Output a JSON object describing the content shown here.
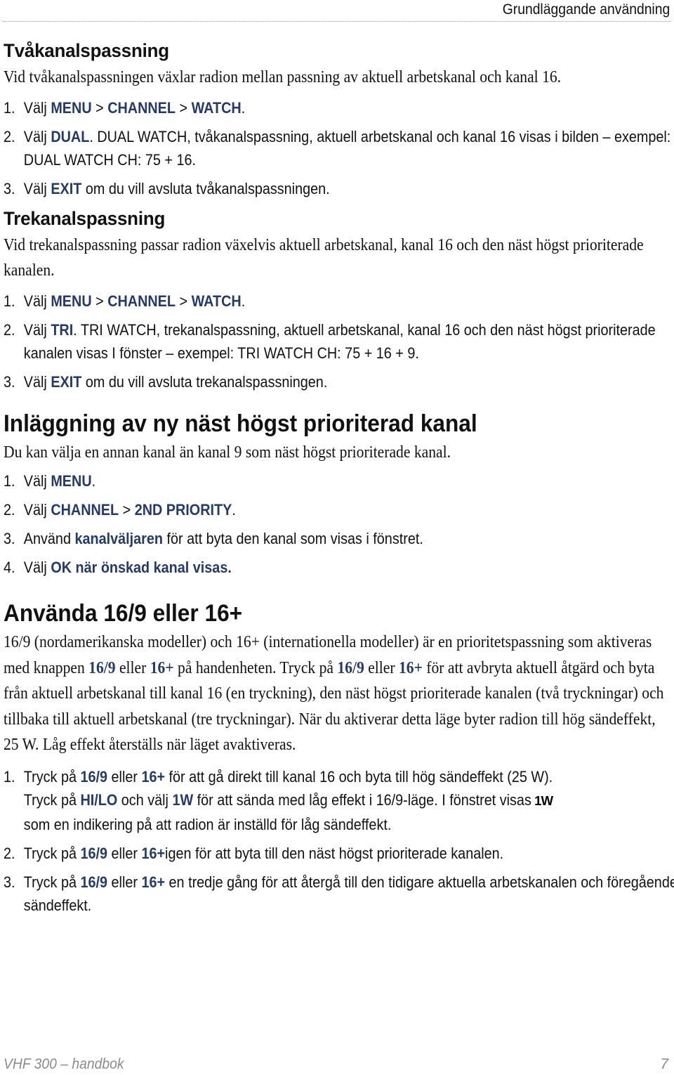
{
  "header": {
    "section_title": "Grundläggande användning"
  },
  "sections": {
    "dual": {
      "heading": "Tvåkanalspassning",
      "intro": "Vid tvåkanalspassningen växlar radion mellan passning av aktuell arbetskanal och kanal 16.",
      "steps": [
        {
          "num": "1.",
          "pre": "Välj ",
          "k1": "MENU",
          "m1": " > ",
          "k2": "CHANNEL",
          "m2": " > ",
          "k3": "WATCH",
          "post": "."
        },
        {
          "num": "2.",
          "pre": "Välj ",
          "k1": "DUAL",
          "post": ". DUAL WATCH, tvåkanalspassning, aktuell arbetskanal och kanal 16 visas i bilden – exempel: DUAL WATCH CH: 75 + 16."
        },
        {
          "num": "3.",
          "pre": "Välj ",
          "k1": "EXIT",
          "post": " om du vill avsluta tvåkanalspassningen."
        }
      ]
    },
    "tri": {
      "heading": "Trekanalspassning",
      "intro": "Vid trekanalspassning passar radion växelvis aktuell arbetskanal, kanal 16 och den näst högst prioriterade kanalen.",
      "steps": [
        {
          "num": "1.",
          "pre": "Välj ",
          "k1": "MENU",
          "m1": " > ",
          "k2": "CHANNEL",
          "m2": " > ",
          "k3": "WATCH",
          "post": "."
        },
        {
          "num": "2.",
          "pre": "Välj ",
          "k1": "TRI",
          "post": ". TRI WATCH, trekanalspassning, aktuell arbetskanal, kanal 16 och den näst högst prioriterade kanalen visas I fönster – exempel: TRI WATCH CH: 75 + 16 + 9."
        },
        {
          "num": "3.",
          "pre": "Välj ",
          "k1": "EXIT",
          "post": " om du vill avsluta trekanalspassningen."
        }
      ]
    },
    "priority": {
      "heading": "Inläggning av ny näst högst prioriterad kanal",
      "intro": "Du kan välja en annan kanal än kanal 9 som näst högst prioriterade kanal.",
      "steps": [
        {
          "num": "1.",
          "pre": "Välj ",
          "k1": "MENU",
          "post": "."
        },
        {
          "num": "2.",
          "pre": "Välj ",
          "k1": "CHANNEL",
          "m1": " > ",
          "k2": "2ND PRIORITY",
          "post": "."
        },
        {
          "num": "3.",
          "pre": "Använd ",
          "k1": "kanalväljaren",
          "post": " för att byta den kanal som visas i fönstret."
        },
        {
          "num": "4.",
          "pre": "Välj ",
          "k1": "OK när önskad kanal visas.",
          "post": ""
        }
      ]
    },
    "sixteen": {
      "heading": "Använda 16/9 eller 16+",
      "intro": {
        "p1": "16/9 (nordamerikanska modeller) och 16+ (internationella modeller) är en prioritetspassning som aktiveras med knappen ",
        "k1": "16/9",
        "p2": " eller ",
        "k2": "16+",
        "p3": " på handenheten. Tryck på ",
        "k3": "16/9",
        "p4": " eller ",
        "k4": "16+",
        "p5": " för att avbryta aktuell åtgärd och byta från aktuell arbetskanal till kanal 16 (en tryckning), den näst högst prioriterade kanalen (två tryckningar) och tillbaka till aktuell arbetskanal (tre tryckningar). När du aktiverar detta läge byter radion till hög sändeffekt,",
        "p6": "25 W. Låg effekt återställs när läget avaktiveras."
      },
      "steps": [
        {
          "num": "1.",
          "t1": "Tryck på ",
          "k1": "16/9",
          "t2": " eller ",
          "k2": "16+",
          "t3": " för att gå direkt till kanal 16 och byta till hög sändeffekt (25 W).",
          "t4": "Tryck på ",
          "k3": "HI/LO",
          "t5": " och välj ",
          "k4": "1W",
          "t6": " för att sända med låg effekt i 16/9-läge. I fönstret visas ",
          "icon_label": "1W",
          "t7": "som en indikering på att radion är inställd för låg sändeffekt."
        },
        {
          "num": "2.",
          "t1": "Tryck på ",
          "k1": "16/9",
          "t2": " eller ",
          "k2": "16+",
          "t3": "igen för att byta till den näst högst prioriterade kanalen."
        },
        {
          "num": "3.",
          "t1": "Tryck på ",
          "k1": "16/9",
          "t2": " eller ",
          "k2": "16+",
          "t3": " en tredje gång för att återgå till den tidigare aktuella arbetskanalen och föregående sändeffekt."
        }
      ]
    }
  },
  "footer": {
    "doc_title": "VHF 300 – handbok",
    "page_number": "7"
  },
  "colors": {
    "keyword": "#243a6b",
    "footer_text": "#8a8a8a"
  }
}
